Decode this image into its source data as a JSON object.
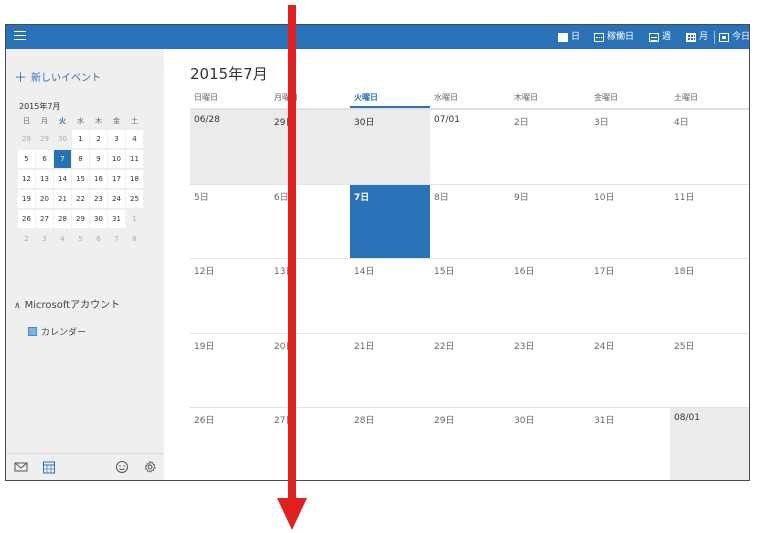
{
  "toolbar": {
    "day_label": "日",
    "workweek_label": "稼働日",
    "week_label": "週",
    "month_label": "月",
    "today_label": "今日"
  },
  "sidebar": {
    "new_event": "新しいイベント",
    "mini_month_title": "2015年7月",
    "weekday_heads": [
      "日",
      "月",
      "火",
      "水",
      "木",
      "金",
      "土"
    ],
    "mini_days": [
      [
        "28",
        "29",
        "30",
        "1",
        "2",
        "3",
        "4"
      ],
      [
        "5",
        "6",
        "7",
        "8",
        "9",
        "10",
        "11"
      ],
      [
        "12",
        "13",
        "14",
        "15",
        "16",
        "17",
        "18"
      ],
      [
        "19",
        "20",
        "21",
        "22",
        "23",
        "24",
        "25"
      ],
      [
        "26",
        "27",
        "28",
        "29",
        "30",
        "31",
        "1"
      ],
      [
        "2",
        "3",
        "4",
        "5",
        "6",
        "7",
        "8"
      ]
    ],
    "account_label": "Microsoftアカウント",
    "calendar_name": "カレンダー"
  },
  "main": {
    "month_title": "2015年7月",
    "day_headers": [
      "日曜日",
      "月曜日",
      "火曜日",
      "水曜日",
      "木曜日",
      "金曜日",
      "土曜日"
    ],
    "weeks": [
      [
        "06/28",
        "29日",
        "30日",
        "07/01",
        "2日",
        "3日",
        "4日"
      ],
      [
        "5日",
        "6日",
        "7日",
        "8日",
        "9日",
        "10日",
        "11日"
      ],
      [
        "12日",
        "13日",
        "14日",
        "15日",
        "16日",
        "17日",
        "18日"
      ],
      [
        "19日",
        "20日",
        "21日",
        "22日",
        "23日",
        "24日",
        "25日"
      ],
      [
        "26日",
        "27日",
        "28日",
        "29日",
        "30日",
        "31日",
        "08/01"
      ]
    ]
  },
  "colors": {
    "accent": "#2a72b7",
    "arrow": "#e02020",
    "sidebar_bg": "#efefef",
    "grey_cell": "#ebebeb"
  }
}
